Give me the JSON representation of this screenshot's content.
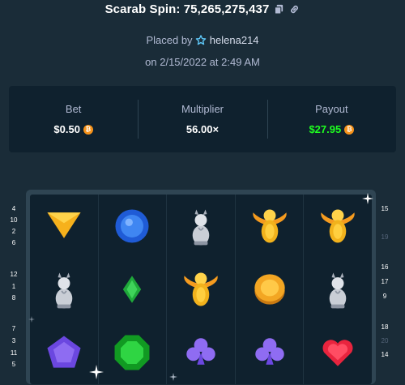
{
  "header": {
    "title": "Scarab Spin: 75,265,275,437",
    "copy_icon": "copy-icon",
    "link_icon": "link-icon"
  },
  "placed": {
    "prefix": "Placed by",
    "user": "helena214",
    "date": "on 2/15/2022 at 2:49 AM"
  },
  "stats": {
    "bet_label": "Bet",
    "bet_value": "$0.50",
    "multiplier_label": "Multiplier",
    "multiplier_value": "56.00×",
    "payout_label": "Payout",
    "payout_value": "$27.95",
    "currency_icon": "bitcoin-icon",
    "payout_color": "#1fff20"
  },
  "paylines": {
    "left": [
      "4",
      "10",
      "2",
      "6",
      "12",
      "1",
      "8",
      "7",
      "3",
      "11",
      "5"
    ],
    "right": [
      "15",
      "19",
      "16",
      "17",
      "9",
      "18",
      "20",
      "14"
    ],
    "right_dim": [
      "19",
      "20"
    ]
  },
  "reels": [
    [
      "yellow-triangle",
      "blue-circle-gem",
      "cat-statue",
      "golden-scarab",
      "golden-scarab"
    ],
    [
      "cat-statue",
      "green-diamond",
      "golden-scarab",
      "gold-coin",
      "cat-statue"
    ],
    [
      "purple-pentagon",
      "green-octagon",
      "purple-club",
      "purple-club",
      "red-heart"
    ]
  ]
}
